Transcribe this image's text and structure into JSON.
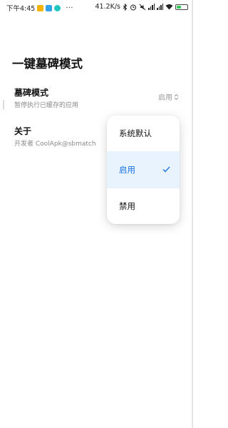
{
  "status_bar": {
    "time": "下午4:45",
    "dots": "···",
    "net_speed": "41.2K/s",
    "battery_level": 0.45
  },
  "page": {
    "title": "一键墓碑模式"
  },
  "settings": {
    "mode": {
      "title": "墓碑模式",
      "subtitle": "暂停执行已缓存的应用",
      "value": "启用"
    },
    "about": {
      "title": "关于",
      "subtitle": "开发者 CoolApk@sbmatch"
    }
  },
  "dropdown": {
    "options": [
      {
        "label": "系统默认",
        "selected": false
      },
      {
        "label": "启用",
        "selected": true
      },
      {
        "label": "禁用",
        "selected": false
      }
    ]
  },
  "colors": {
    "accent": "#1a73e8",
    "selected_bg": "#e9f3fd",
    "battery": "#34c759"
  }
}
